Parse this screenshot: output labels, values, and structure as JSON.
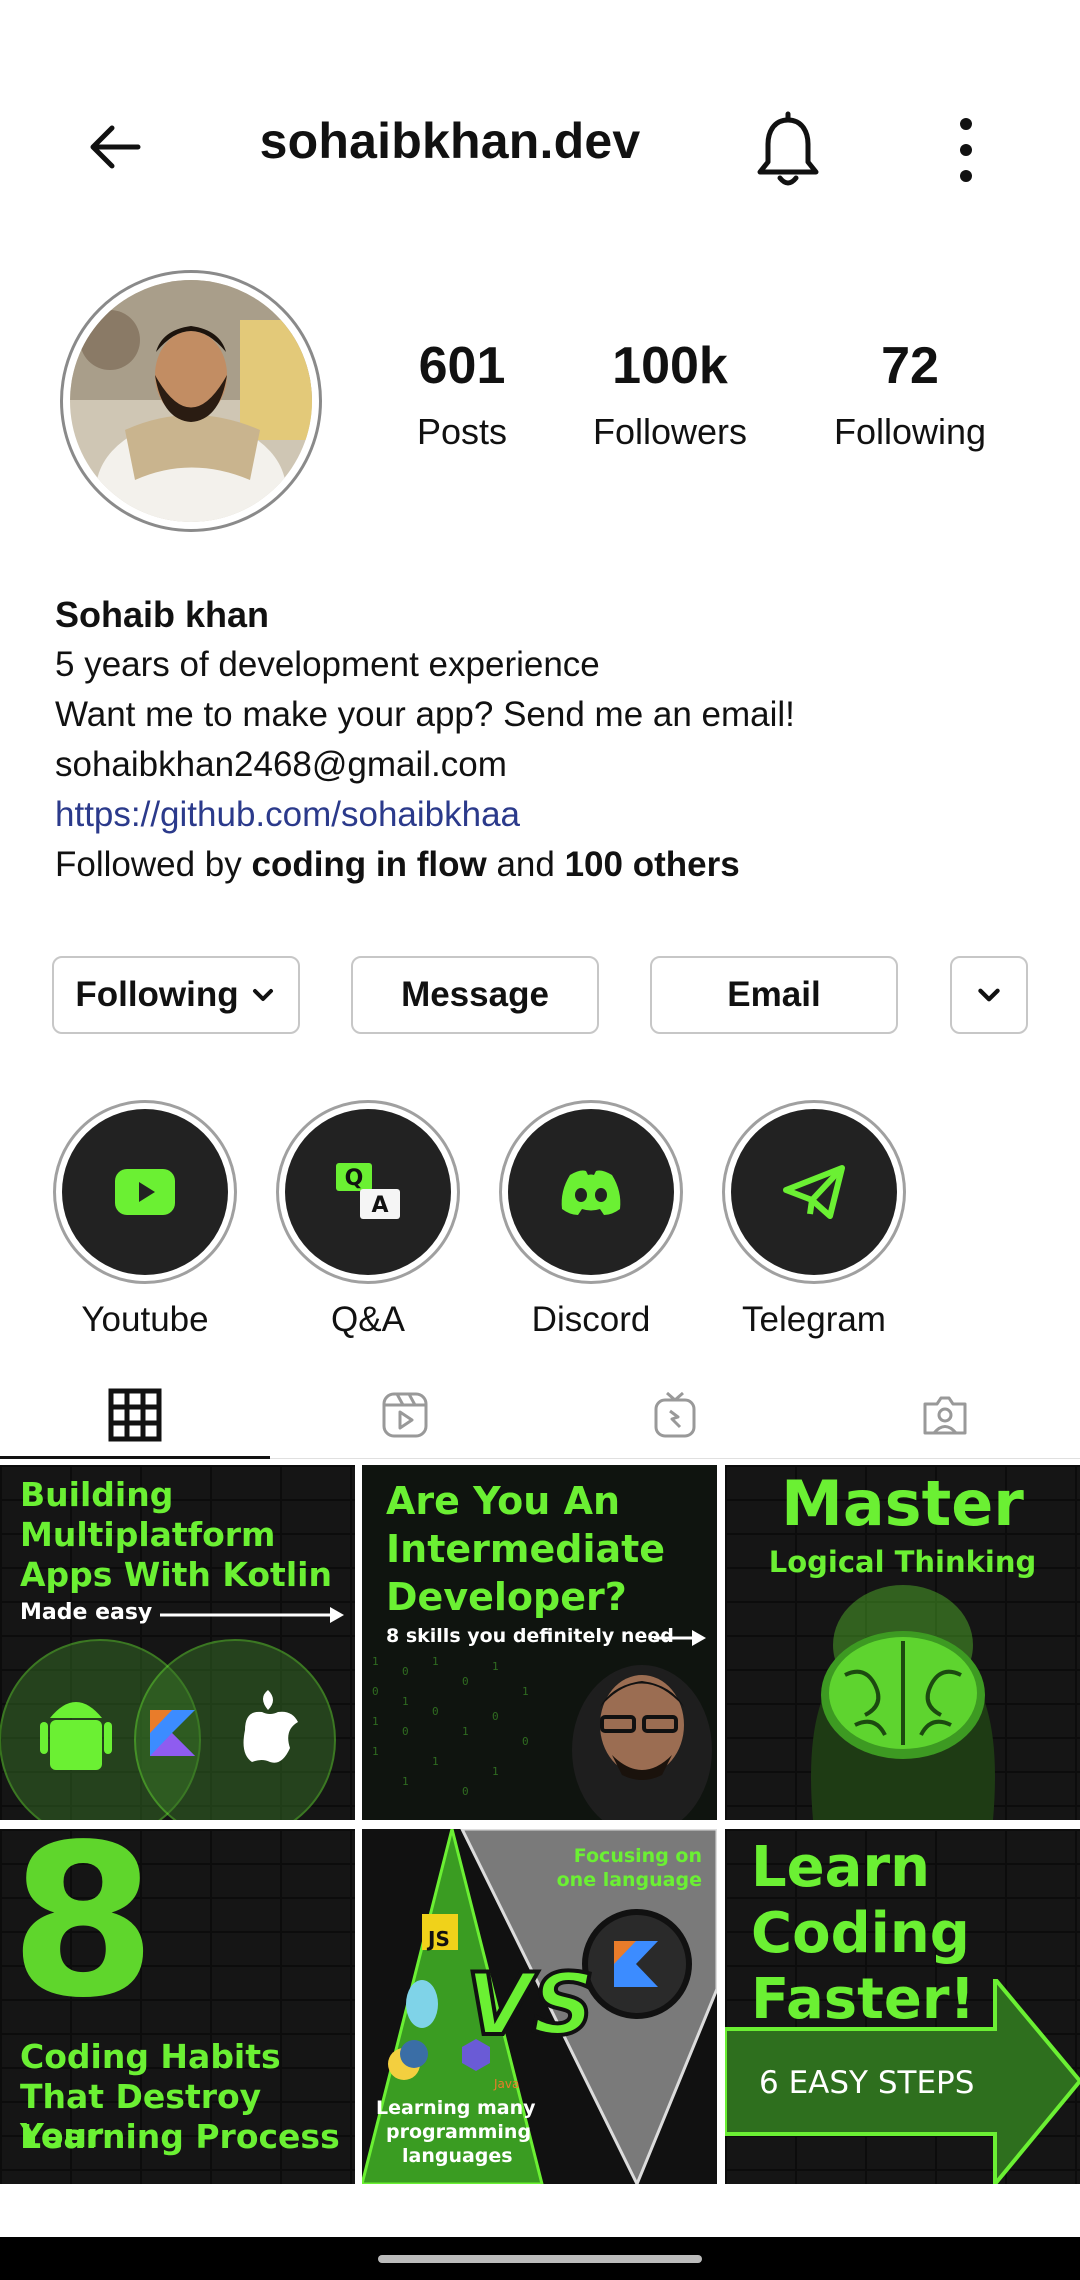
{
  "header": {
    "username": "sohaibkhan.dev"
  },
  "stats": [
    {
      "value": "601",
      "label": "Posts"
    },
    {
      "value": "100k",
      "label": "Followers"
    },
    {
      "value": "72",
      "label": "Following"
    }
  ],
  "bio": {
    "name": "Sohaib khan",
    "line1": "5 years of development experience",
    "line2": "Want me to make your app? Send me an email!",
    "email": "sohaibkhan2468@gmail.com",
    "link": "https://github.com/sohaibkhaa",
    "followed_prefix": "Followed by ",
    "followed_user": "coding in flow",
    "followed_mid": " and ",
    "followed_others": "100 others"
  },
  "buttons": {
    "following": "Following",
    "message": "Message",
    "email": "Email"
  },
  "highlights": [
    {
      "label": "Youtube",
      "icon": "youtube-icon"
    },
    {
      "label": "Q&A",
      "icon": "qa-icon"
    },
    {
      "label": "Discord",
      "icon": "discord-icon"
    },
    {
      "label": "Telegram",
      "icon": "telegram-icon"
    }
  ],
  "tabs": [
    {
      "icon": "grid-icon",
      "active": true
    },
    {
      "icon": "reels-icon",
      "active": false
    },
    {
      "icon": "igtv-icon",
      "active": false
    },
    {
      "icon": "tagged-icon",
      "active": false
    }
  ],
  "posts": [
    {
      "l1": "Building",
      "l2": "Multiplatform",
      "l3": "Apps With Kotlin",
      "sub": "Made easy"
    },
    {
      "l1": "Are You An",
      "l2": "Intermediate",
      "l3": "Developer?",
      "sub": "8 skills you definitely need"
    },
    {
      "l1": "Master",
      "l2": "Logical Thinking"
    },
    {
      "big": "8",
      "l1": "Coding Habits",
      "l2": "That Destroy Your",
      "l3": "Learning Process"
    },
    {
      "vs": "VS",
      "top": "Focusing on",
      "top2": "one language",
      "bot": "Learning many",
      "bot2": "programming",
      "bot3": "languages",
      "js": "JS",
      "java": "Java"
    },
    {
      "l1": "Learn",
      "l2": "Coding",
      "l3": "Faster!",
      "sub": "6 EASY STEPS"
    }
  ],
  "colors": {
    "accent_green": "#6bf033",
    "link_blue": "#2b3a8b"
  }
}
